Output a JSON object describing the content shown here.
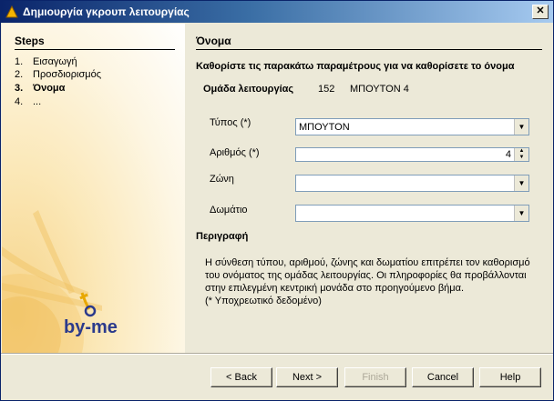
{
  "window": {
    "title": "Δημιουργία γκρουπ λειτουργίας",
    "close_label": "✕"
  },
  "steps": {
    "title": "Steps",
    "items": [
      {
        "num": "1.",
        "label": "Εισαγωγή",
        "active": false
      },
      {
        "num": "2.",
        "label": "Προσδιορισμός",
        "active": false
      },
      {
        "num": "3.",
        "label": "Όνομα",
        "active": true
      },
      {
        "num": "4.",
        "label": "...",
        "active": false
      }
    ]
  },
  "logo": {
    "text": "by-me"
  },
  "content": {
    "title": "Όνομα",
    "instruction": "Καθορίστε τις παρακάτω παραμέτρους για να καθορίσετε το όνομα",
    "group": {
      "label": "Ομάδα λειτουργίας",
      "number": "152",
      "name": "ΜΠΟΥΤΟΝ 4"
    },
    "fields": {
      "type": {
        "label": "Τύπος (*)",
        "value": "ΜΠΟΥΤΟΝ"
      },
      "number": {
        "label": "Αριθμός (*)",
        "value": "4"
      },
      "zone": {
        "label": "Ζώνη",
        "value": ""
      },
      "room": {
        "label": "Δωμάτιο",
        "value": ""
      }
    },
    "description": {
      "title": "Περιγραφή",
      "lines": [
        "Η σύνθεση τύπου, αριθμού, ζώνης και δωματίου επιτρέπει τον καθορισμό",
        "του ονόματος της ομάδας λειτουργίας. Οι πληροφορίες θα προβάλλονται",
        "στην επιλεγμένη κεντρική μονάδα  στο προηγούμενο βήμα.",
        "(* Υποχρεωτικό δεδομένο)"
      ]
    }
  },
  "buttons": {
    "back": "< Back",
    "next": "Next >",
    "finish": "Finish",
    "cancel": "Cancel",
    "help": "Help"
  },
  "colors": {
    "titlebar_start": "#0a246a",
    "titlebar_end": "#a6caf0",
    "dialog_bg": "#ece9d8",
    "logo_text": "#2b3a8c"
  }
}
